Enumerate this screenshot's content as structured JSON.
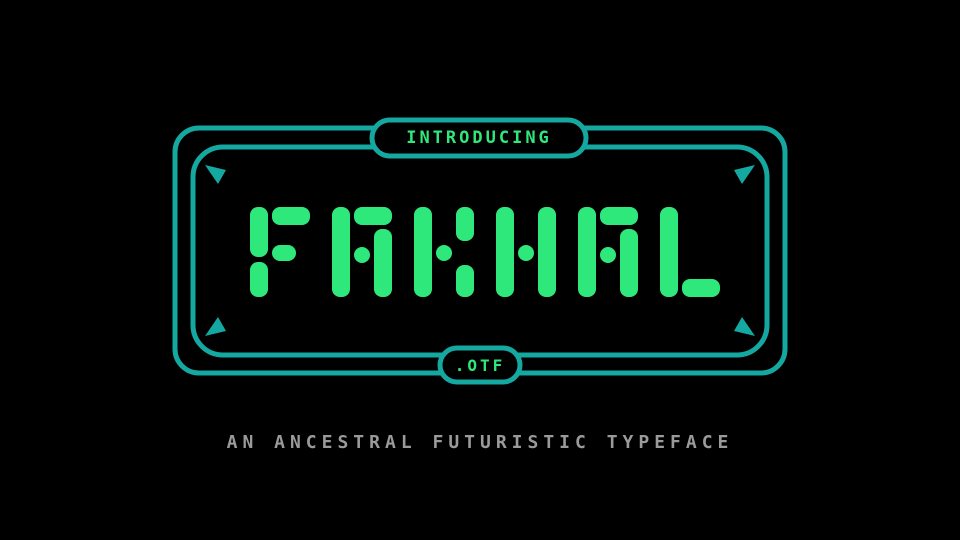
{
  "badge": {
    "top_label": "INTRODUCING",
    "bottom_label": ".OTF"
  },
  "font_name": "FAKHAL",
  "tagline": "AN ANCESTRAL FUTURISTIC TYPEFACE",
  "colors": {
    "background": "#000000",
    "frame": "#14a8a0",
    "accent_text": "#2ee87c",
    "tagline": "#9a9a9a"
  }
}
